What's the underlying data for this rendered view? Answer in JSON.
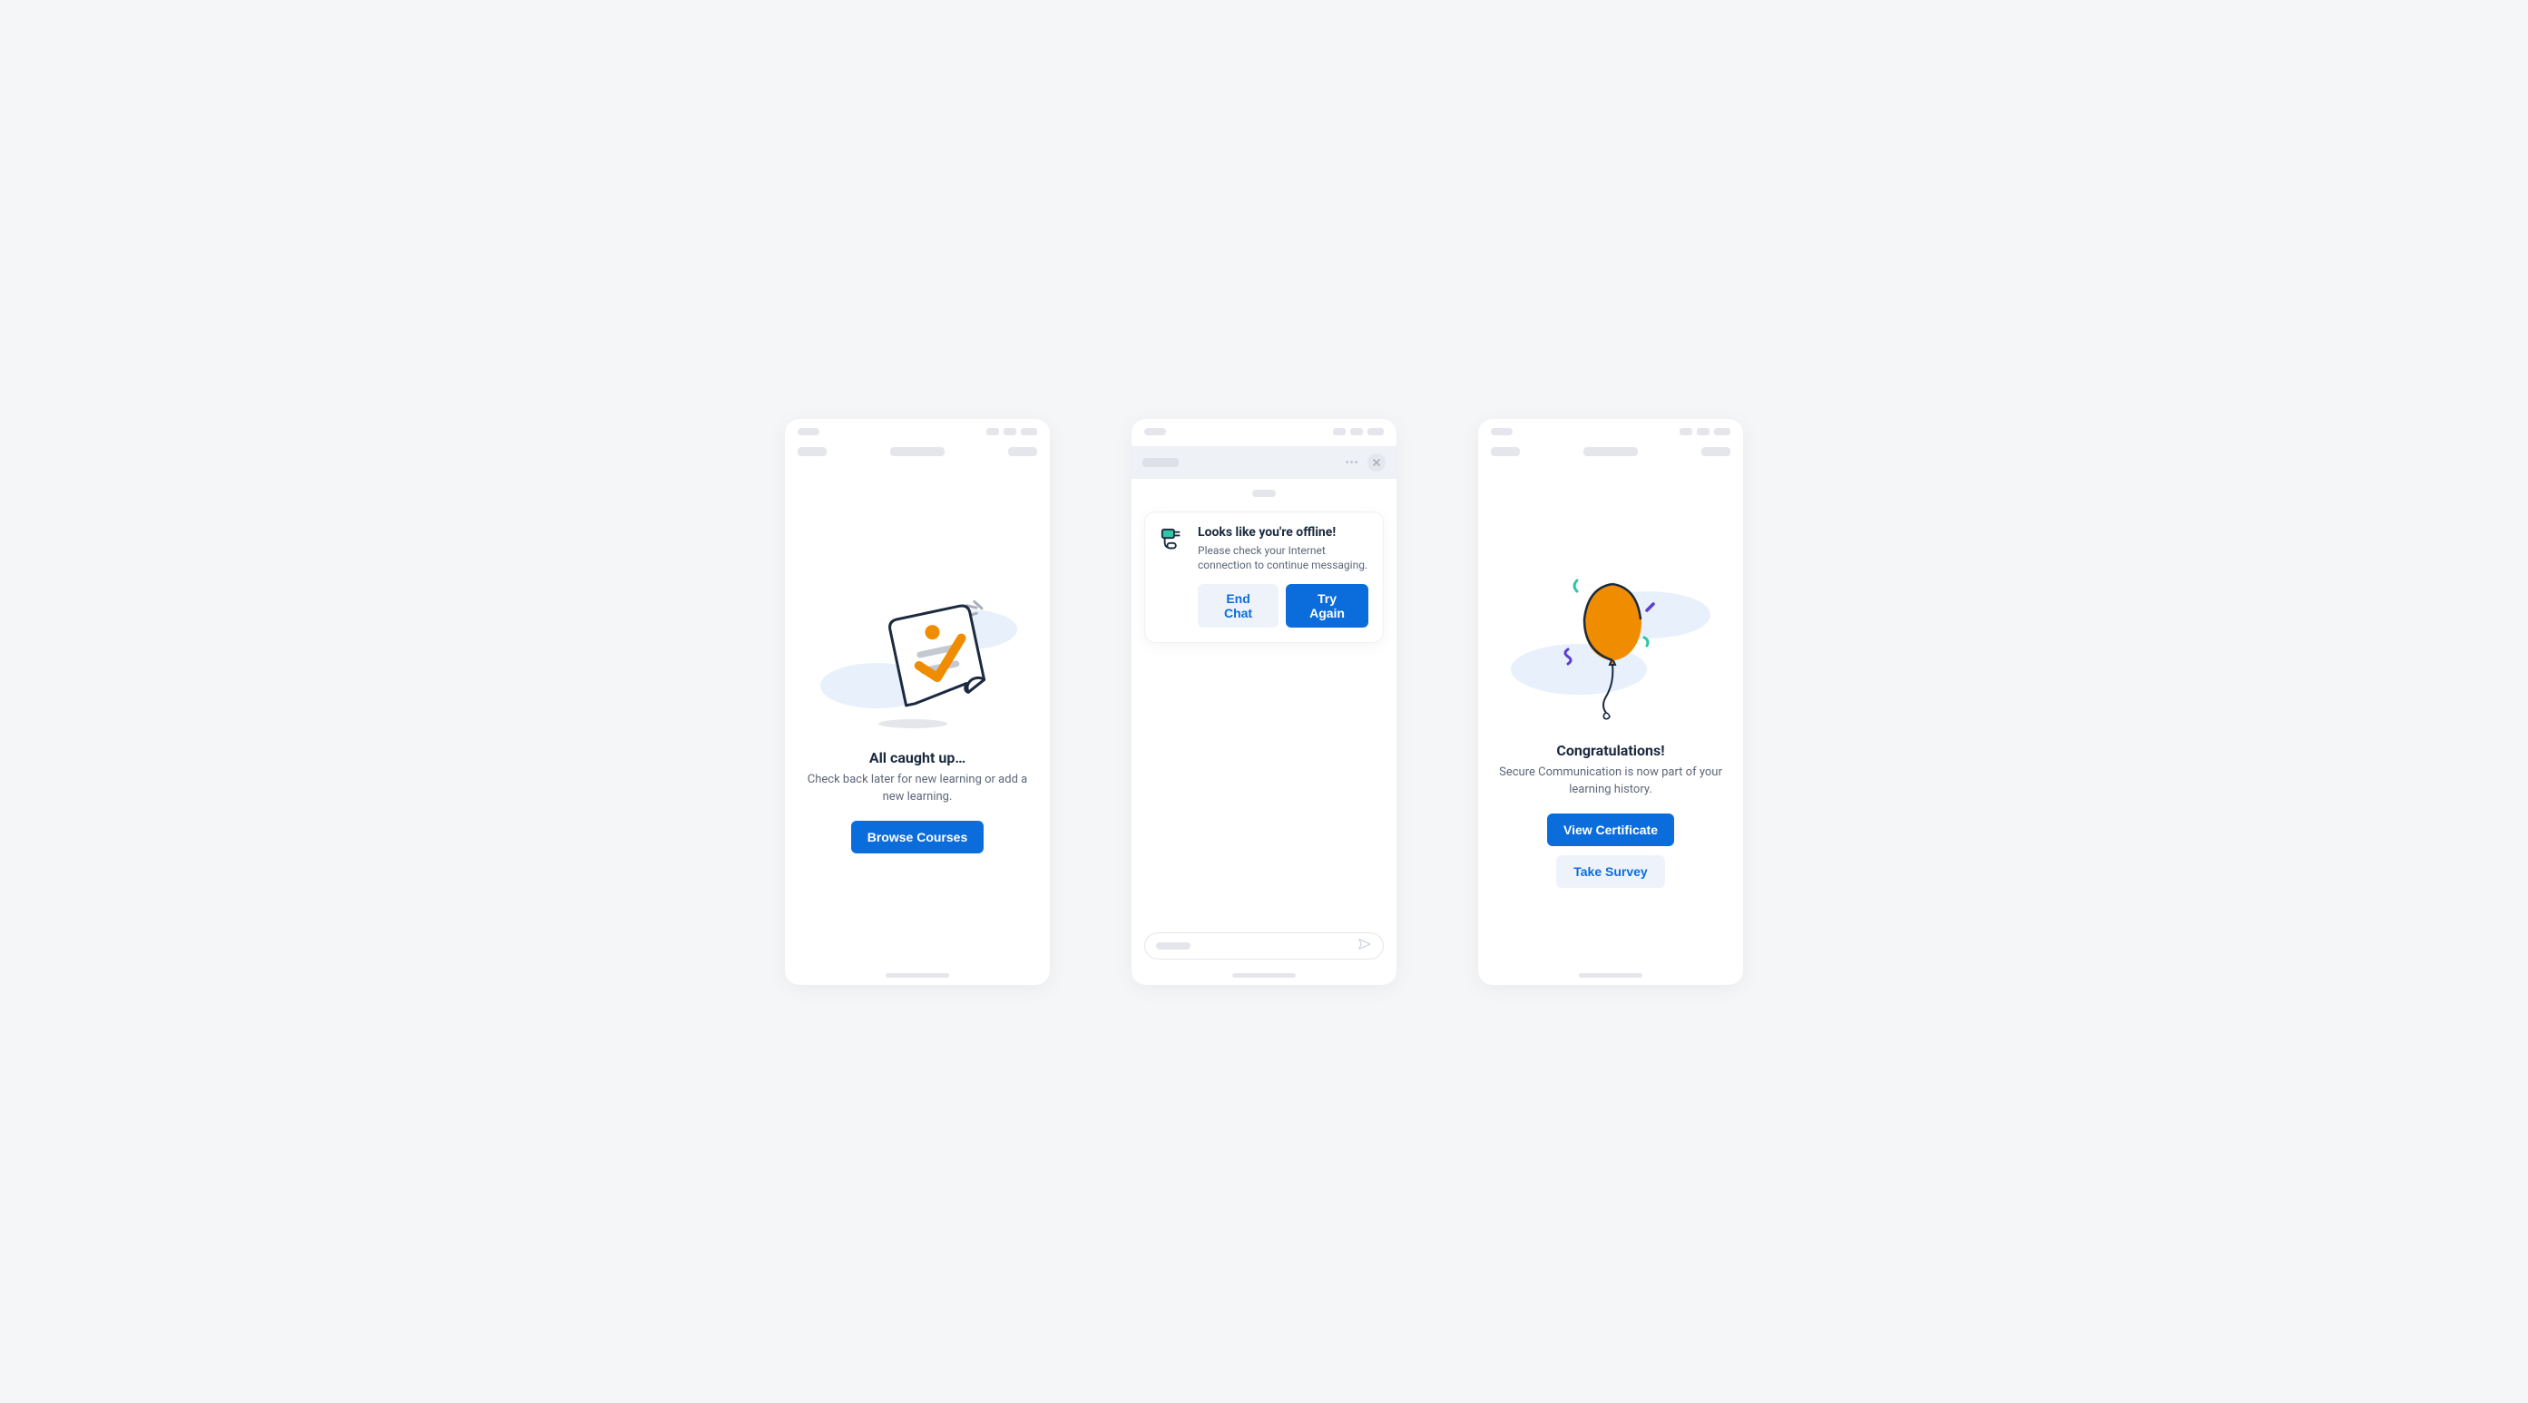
{
  "colors": {
    "primary": "#0b6ddb",
    "secondary_bg": "#eef3fb",
    "text_dark": "#1b2a3f",
    "text_muted": "#5c6778",
    "accent_orange": "#f08c00",
    "cloud": "#e7f0fb"
  },
  "screen1": {
    "title": "All caught up…",
    "description": "Check back later for new learning or add a new learning.",
    "primary_button": "Browse Courses"
  },
  "screen2": {
    "alert_title": "Looks like you're offline!",
    "alert_description": "Please check your Internet connection to continue messaging.",
    "end_chat_button": "End Chat",
    "try_again_button": "Try Again"
  },
  "screen3": {
    "title": "Congratulations!",
    "description": "Secure Communication is now part of your learning history.",
    "primary_button": "View Certificate",
    "secondary_button": "Take Survey"
  }
}
